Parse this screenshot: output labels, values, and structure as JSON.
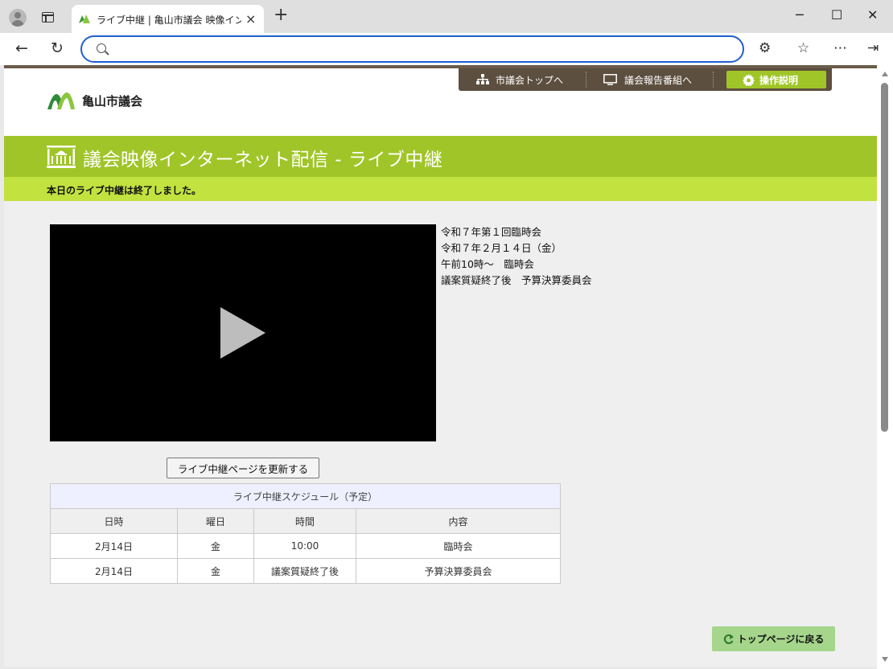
{
  "browser": {
    "tab_title": "ライブ中継 | 亀山市議会 映像インターネット配信",
    "tab_close": "×",
    "new_tab": "+",
    "address_value": "",
    "icons": {
      "back": "←",
      "reload": "↻",
      "extensions": "⚙",
      "favorites": "☆",
      "more": "⋯",
      "sidebar": "⇥",
      "minimize": "─",
      "maximize": "☐",
      "close": "✕"
    }
  },
  "site": {
    "logo_text": "亀山市議会",
    "topnav": [
      {
        "label": "市議会トップへ",
        "icon": "sitemap-icon"
      },
      {
        "label": "議会報告番組へ",
        "icon": "monitor-icon"
      },
      {
        "label": "操作説明",
        "icon": "gear-icon"
      }
    ],
    "banner_title": "議会映像インターネット配信 - ライブ中継",
    "notice": "本日のライブ中継は終了しました。"
  },
  "session": {
    "line1": "令和７年第１回臨時会",
    "line2": "令和７年２月１４日（金）",
    "line3": "午前10時～　臨時会",
    "line4": "議案質疑終了後　予算決算委員会"
  },
  "refresh_button": "ライブ中継ページを更新する",
  "schedule": {
    "caption": "ライブ中継スケジュール（予定）",
    "headers": [
      "日時",
      "曜日",
      "時間",
      "内容"
    ],
    "rows": [
      [
        "2月14日",
        "金",
        "10:00",
        "臨時会"
      ],
      [
        "2月14日",
        "金",
        "議案質疑終了後",
        "予算決算委員会"
      ]
    ]
  },
  "back_to_top": "トップページに戻る",
  "colors": {
    "brand_green": "#a0c528",
    "notice_green": "#c2e23f",
    "nav_brown": "#5d4f3f",
    "back_button": "#a5d68b"
  }
}
